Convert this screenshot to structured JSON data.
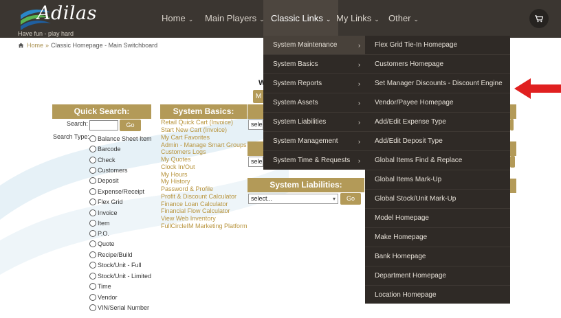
{
  "brand": {
    "name": "Adilas",
    "tagline": "Have fun - play hard"
  },
  "nav": {
    "items": [
      {
        "label": "Home"
      },
      {
        "label": "Main Players"
      },
      {
        "label": "Classic Links"
      },
      {
        "label": "My Links"
      },
      {
        "label": "Other"
      }
    ],
    "chevron": "⌄"
  },
  "breadcrumb": {
    "home": "Home",
    "sep": "»",
    "current": "Classic Homepage - Main Switchboard"
  },
  "quick_search": {
    "title": "Quick Search:",
    "search_label": "Search:",
    "go_label": "Go",
    "type_label": "Search Type:",
    "types": [
      "Balance Sheet Item",
      "Barcode",
      "Check",
      "Customers",
      "Deposit",
      "Expense/Receipt",
      "Flex Grid",
      "Invoice",
      "Item",
      "P.O.",
      "Quote",
      "Recipe/Build",
      "Stock/Unit - Full",
      "Stock/Unit - Limited",
      "Time",
      "Vendor",
      "VIN/Serial Number"
    ]
  },
  "system_basics": {
    "title": "System Basics:",
    "links": [
      "Retail Quick Cart (Invoice)",
      "Start New Cart (Invoice)",
      "My Cart Favorites",
      "Admin - Manage Smart Groups",
      "Customers Logs",
      "My Quotes",
      "Clock In/Out",
      "My Hours",
      "My History",
      "Password & Profile",
      "Profit & Discount Calculator",
      "Finance Loan Calculator",
      "Financial Flow Calculator",
      "View Web Inventory",
      "FullCircleIM Marketing Platform"
    ]
  },
  "center": {
    "heading_fragment": "W",
    "button_fragment": "M",
    "select_fragment_1": "selec",
    "select_fragment_2": "sele"
  },
  "system_liabilities": {
    "title": "System Liabilities:",
    "select_value": "select...",
    "go_label": "Go"
  },
  "menu": {
    "left": [
      {
        "label": "System Maintenance",
        "arrow": "›"
      },
      {
        "label": "System Basics",
        "arrow": "›"
      },
      {
        "label": "System Reports",
        "arrow": "›"
      },
      {
        "label": "System Assets",
        "arrow": "›"
      },
      {
        "label": "System Liabilities",
        "arrow": "›"
      },
      {
        "label": "System Management",
        "arrow": "›"
      },
      {
        "label": "System Time & Requests",
        "arrow": "›"
      }
    ],
    "right": [
      "Flex Grid Tie-In Homepage",
      "Customers Homepage",
      "Set Manager Discounts - Discount Engine",
      "Vendor/Payee Homepage",
      "Add/Edit Expense Type",
      "Add/Edit Deposit Type",
      "Global Items Find & Replace",
      "Global Items Mark-Up",
      "Global Stock/Unit Mark-Up",
      "Model Homepage",
      "Make Homepage",
      "Bank Homepage",
      "Department Homepage",
      "Location Homepage"
    ]
  },
  "icons": {
    "home": "home-icon",
    "cart": "cart-icon",
    "arrow": "red-arrow-icon"
  },
  "colors": {
    "header": "#3b3631",
    "menu": "#2f2a26",
    "gold": "#b39a58",
    "link": "#b8943d",
    "arrow": "#e02020"
  }
}
